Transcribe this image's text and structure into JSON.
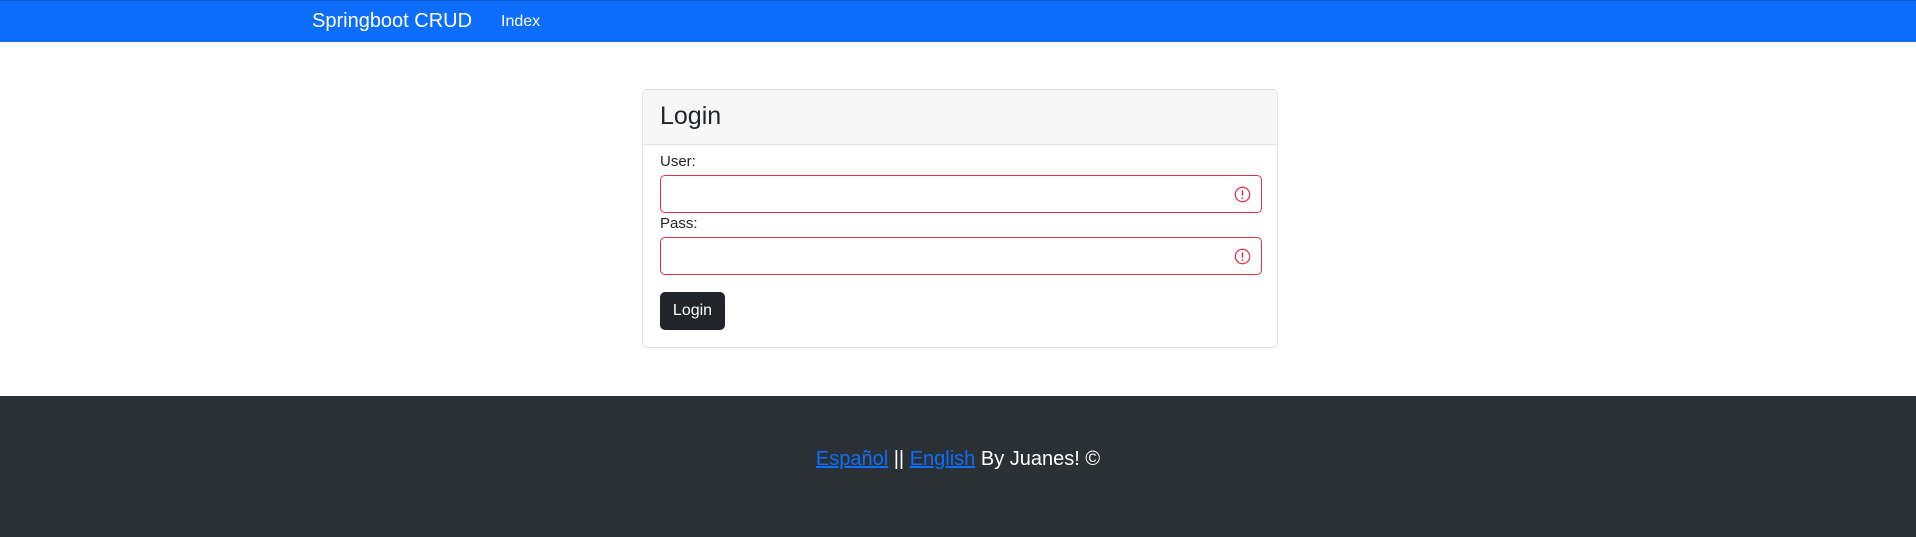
{
  "navbar": {
    "brand": "Springboot CRUD",
    "links": [
      {
        "label": "Index"
      }
    ],
    "bg_color": "#0d6efd"
  },
  "login_card": {
    "title": "Login",
    "user_label": "User:",
    "user_value": "",
    "pass_label": "Pass:",
    "pass_value": "",
    "invalid_icon": "exclamation-circle-icon",
    "invalid_color": "#dc3545",
    "submit_label": "Login"
  },
  "footer": {
    "lang_es": "Español",
    "separator": "||",
    "lang_en": "English",
    "credit": "By Juanes! ©",
    "bg_color": "#2b3035"
  }
}
